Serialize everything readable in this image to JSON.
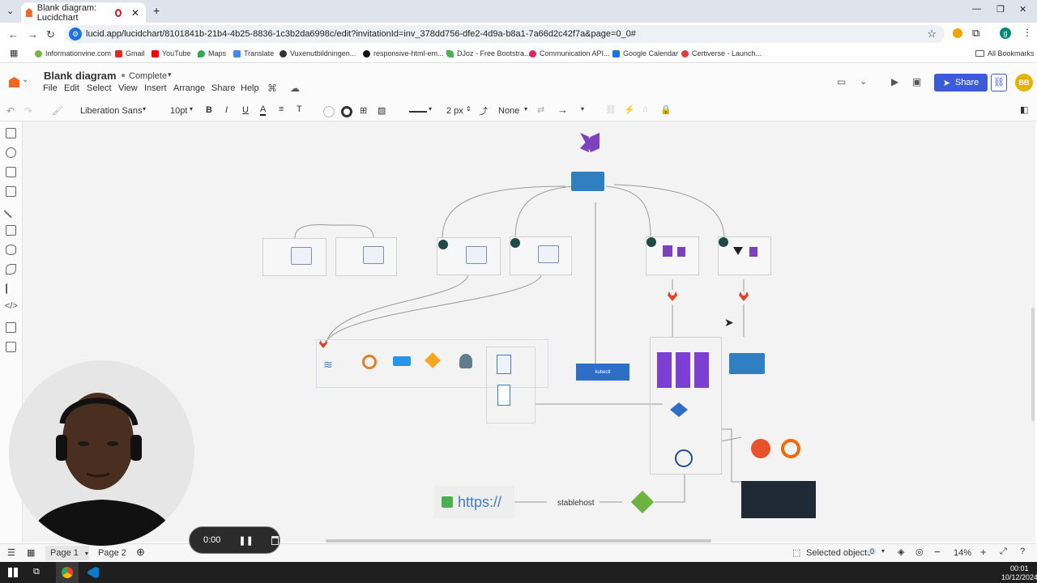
{
  "browser": {
    "tab_title": "Blank diagram: Lucidchart",
    "url": "lucid.app/lucidchart/8101841b-21b4-4b25-8836-1c3b2da6998c/edit?invitationId=inv_378dd756-dfe2-4d9a-b8a1-7a66d2c42f7a&page=0_0#",
    "bookmarks": [
      {
        "label": "Informationvine.com",
        "color": "#7cb342"
      },
      {
        "label": "Gmail",
        "color": "#d93025"
      },
      {
        "label": "YouTube",
        "color": "#ff0000"
      },
      {
        "label": "Maps",
        "color": "#34a853"
      },
      {
        "label": "Translate",
        "color": "#4285f4"
      },
      {
        "label": "Vuxenutbildningen...",
        "color": "#333333"
      },
      {
        "label": "responsive-html-em...",
        "color": "#111111"
      },
      {
        "label": "DJoz - Free Bootstra...",
        "color": "#4caf50"
      },
      {
        "label": "Communication API...",
        "color": "#e91e63"
      },
      {
        "label": "Google Calendar",
        "color": "#1a73e8"
      },
      {
        "label": "Certiverse - Launch...",
        "color": "#e53935"
      }
    ],
    "all_bookmarks": "All Bookmarks"
  },
  "lucid": {
    "doc_title": "Blank diagram",
    "status": "Complete",
    "menus": [
      "File",
      "Edit",
      "Select",
      "View",
      "Insert",
      "Arrange",
      "Share",
      "Help"
    ],
    "share_label": "Share",
    "avatar": "BB",
    "font": "Liberation Sans",
    "font_size": "10pt",
    "line_width": "2 px",
    "arrow_start": "None"
  },
  "canvas": {
    "kubectl_label": "kubectl",
    "https_label": "https://",
    "stablehost_label": "stablehost"
  },
  "bottom": {
    "page1": "Page 1",
    "page2": "Page 2",
    "selected_objects": "Selected objects",
    "selected_count": "0",
    "zoom": "14%"
  },
  "recorder": {
    "time": "0:00"
  },
  "taskbar": {
    "time": "00:01",
    "date": "10/12/2024"
  }
}
